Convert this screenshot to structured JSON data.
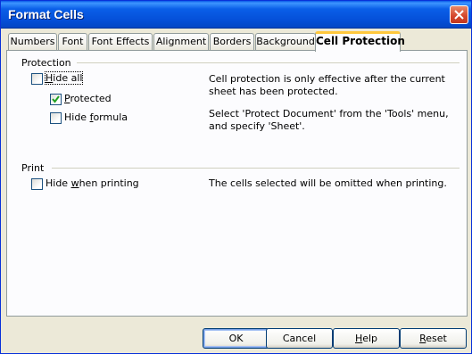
{
  "window": {
    "title": "Format Cells"
  },
  "tabs": [
    {
      "label": "Numbers"
    },
    {
      "label": "Font"
    },
    {
      "label": "Font Effects"
    },
    {
      "label": "Alignment"
    },
    {
      "label": "Borders"
    },
    {
      "label": "Background"
    },
    {
      "label": "Cell Protection",
      "active": true
    }
  ],
  "protection": {
    "heading": "Protection",
    "hide_all": {
      "label_pre": "",
      "label_u": "H",
      "label_post": "ide all",
      "checked": false
    },
    "protected": {
      "label_pre": "",
      "label_u": "P",
      "label_post": "rotected",
      "checked": true
    },
    "hide_formula": {
      "label_pre": "Hide ",
      "label_u": "f",
      "label_post": "ormula",
      "checked": false
    },
    "info1": "Cell protection is only effective after the current sheet has been protected.",
    "info2": "Select 'Protect Document' from the 'Tools' menu, and specify 'Sheet'."
  },
  "print": {
    "heading": "Print",
    "hide_printing": {
      "label_pre": "Hide ",
      "label_u": "w",
      "label_post": "hen printing",
      "checked": false
    },
    "info": "The cells selected will be omitted when printing."
  },
  "buttons": {
    "ok": "OK",
    "cancel": "Cancel",
    "help_u": "H",
    "help_post": "elp",
    "reset_u": "R",
    "reset_post": "eset"
  },
  "colors": {
    "titlebar": "#0a5fe8",
    "face": "#ece9d8",
    "tab_highlight": "#ffc83c"
  }
}
